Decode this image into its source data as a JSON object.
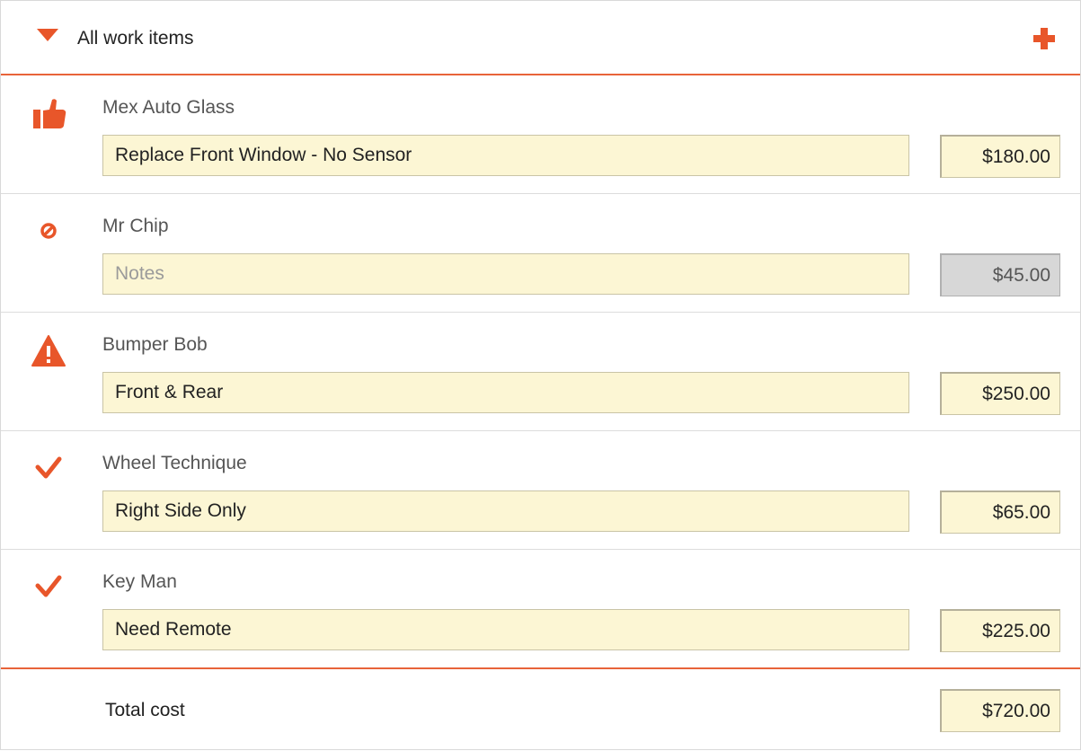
{
  "header": {
    "title": "All work items",
    "toggle_icon": "caret-down-icon",
    "add_icon": "plus-icon"
  },
  "accent_color": "#e8562a",
  "items": [
    {
      "vendor": "Mex Auto Glass",
      "notes": "Replace Front Window - No Sensor",
      "placeholder": "",
      "price": "$180.00",
      "status_icon": "thumbs-up-icon",
      "disabled": false
    },
    {
      "vendor": "Mr Chip",
      "notes": "",
      "placeholder": "Notes",
      "price": "$45.00",
      "status_icon": "prohibited-icon",
      "disabled": true
    },
    {
      "vendor": "Bumper Bob",
      "notes": "Front & Rear",
      "placeholder": "",
      "price": "$250.00",
      "status_icon": "warning-icon",
      "disabled": false
    },
    {
      "vendor": "Wheel Technique",
      "notes": "Right Side Only",
      "placeholder": "",
      "price": "$65.00",
      "status_icon": "checkmark-icon",
      "disabled": false
    },
    {
      "vendor": "Key Man",
      "notes": "Need Remote",
      "placeholder": "",
      "price": "$225.00",
      "status_icon": "checkmark-icon",
      "disabled": false
    }
  ],
  "total": {
    "label": "Total cost",
    "value": "$720.00"
  }
}
